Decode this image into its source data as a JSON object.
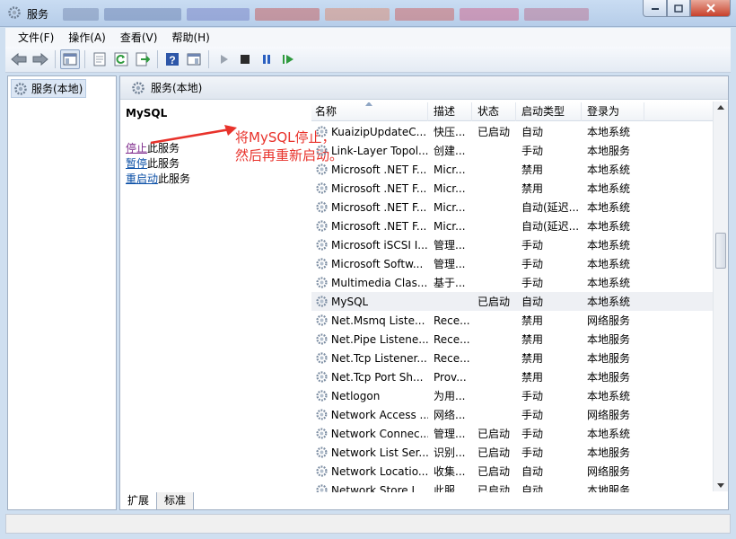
{
  "window": {
    "title": "服务"
  },
  "titlebar_tabs": [
    {
      "color": "#7c8fb7",
      "w": 40
    },
    {
      "color": "#6f86b6",
      "w": 86
    },
    {
      "color": "#7a86c8",
      "w": 70
    },
    {
      "color": "#c46565",
      "w": 72
    },
    {
      "color": "#d98f7a",
      "w": 72
    },
    {
      "color": "#cc6a6a",
      "w": 66
    },
    {
      "color": "#cd6a90",
      "w": 66
    },
    {
      "color": "#b97898",
      "w": 72
    }
  ],
  "menu": [
    "文件(F)",
    "操作(A)",
    "查看(V)",
    "帮助(H)"
  ],
  "tree": {
    "label": "服务(本地)"
  },
  "pane": {
    "header": "服务(本地)",
    "selected_service": "MySQL",
    "actions": [
      {
        "link": "停止",
        "rest": "此服务"
      },
      {
        "link": "暂停",
        "rest": "此服务"
      },
      {
        "link": "重启动",
        "rest": "此服务"
      }
    ],
    "annotation_line1": "将MySQL停止，",
    "annotation_line2": "然后再重新启动。"
  },
  "columns": [
    "名称",
    "描述",
    "状态",
    "启动类型",
    "登录为"
  ],
  "rows": [
    [
      "KuaizipUpdateC...",
      "快压...",
      "已启动",
      "自动",
      "本地系统"
    ],
    [
      "Link-Layer Topol...",
      "创建...",
      "",
      "手动",
      "本地服务"
    ],
    [
      "Microsoft .NET F...",
      "Micr...",
      "",
      "禁用",
      "本地系统"
    ],
    [
      "Microsoft .NET F...",
      "Micr...",
      "",
      "禁用",
      "本地系统"
    ],
    [
      "Microsoft .NET F...",
      "Micr...",
      "",
      "自动(延迟...",
      "本地系统"
    ],
    [
      "Microsoft .NET F...",
      "Micr...",
      "",
      "自动(延迟...",
      "本地系统"
    ],
    [
      "Microsoft iSCSI I...",
      "管理...",
      "",
      "手动",
      "本地系统"
    ],
    [
      "Microsoft Softw...",
      "管理...",
      "",
      "手动",
      "本地系统"
    ],
    [
      "Multimedia Clas...",
      "基于...",
      "",
      "手动",
      "本地系统"
    ],
    [
      "MySQL",
      "",
      "已启动",
      "自动",
      "本地系统"
    ],
    [
      "Net.Msmq Liste...",
      "Rece...",
      "",
      "禁用",
      "网络服务"
    ],
    [
      "Net.Pipe Listene...",
      "Rece...",
      "",
      "禁用",
      "本地服务"
    ],
    [
      "Net.Tcp Listener...",
      "Rece...",
      "",
      "禁用",
      "本地服务"
    ],
    [
      "Net.Tcp Port Sh...",
      "Prov...",
      "",
      "禁用",
      "本地服务"
    ],
    [
      "Netlogon",
      "为用...",
      "",
      "手动",
      "本地系统"
    ],
    [
      "Network Access ...",
      "网络...",
      "",
      "手动",
      "网络服务"
    ],
    [
      "Network Connec...",
      "管理...",
      "已启动",
      "手动",
      "本地系统"
    ],
    [
      "Network List Ser...",
      "识别...",
      "已启动",
      "手动",
      "本地服务"
    ],
    [
      "Network Locatio...",
      "收集...",
      "已启动",
      "自动",
      "网络服务"
    ],
    [
      "Network Store I...",
      "此服...",
      "已启动",
      "自动",
      "本地服务"
    ]
  ],
  "selected_row_index": 9,
  "tabs": [
    "扩展",
    "标准"
  ],
  "active_tab_index": 0
}
